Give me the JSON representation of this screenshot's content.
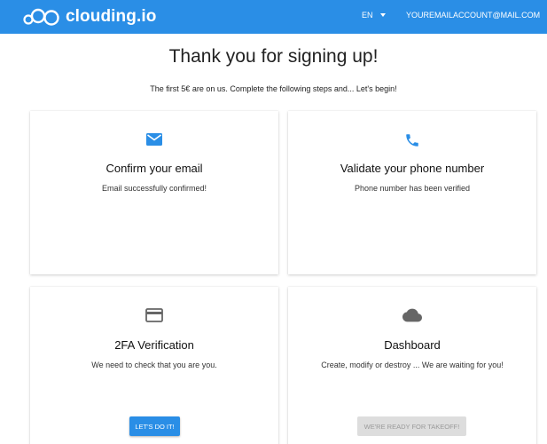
{
  "header": {
    "brand": "clouding.io",
    "language": "EN",
    "account": "YOUREMAILACCOUNT@MAIL.COM",
    "color": "#2a8ee6"
  },
  "main": {
    "title": "Thank you for signing up!",
    "subtitle": "The first 5€ are on us. Complete the following steps and... Let's begin!"
  },
  "cards": [
    {
      "icon": "email-icon",
      "title": "Confirm your email",
      "text": "Email successfully confirmed!"
    },
    {
      "icon": "phone-icon",
      "title": "Validate your phone number",
      "text": "Phone number has been verified"
    },
    {
      "icon": "credit-card-icon",
      "title": "2FA Verification",
      "text": "We need to check that you are you.",
      "button": "LET'S DO IT!"
    },
    {
      "icon": "cloud-icon",
      "title": "Dashboard",
      "text": "Create, modify or destroy ... We are waiting for you!",
      "button": "WE'RE READY FOR TAKEOFF!"
    }
  ]
}
